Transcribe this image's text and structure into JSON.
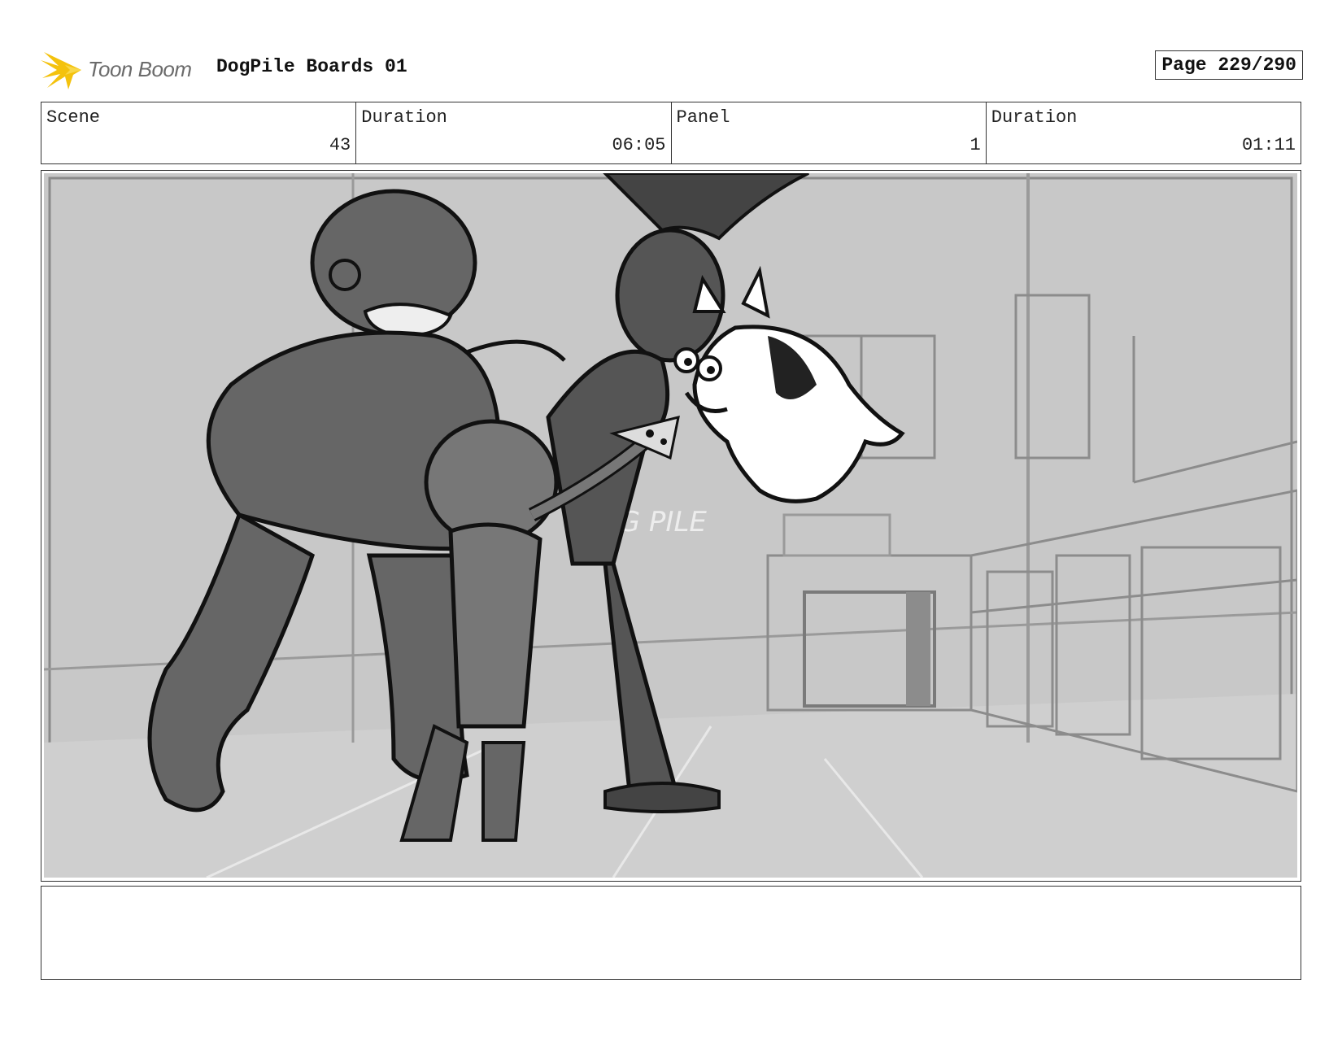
{
  "header": {
    "logo_text": "Toon Boom",
    "title": "DogPile Boards 01",
    "page_label": "Page 229/290"
  },
  "info": [
    {
      "label": "Scene",
      "value": "43"
    },
    {
      "label": "Duration",
      "value": "06:05"
    },
    {
      "label": "Panel",
      "value": "1"
    },
    {
      "label": "Duration",
      "value": "01:11"
    }
  ],
  "colors": {
    "logo_accent": "#f4c20d",
    "sketch_background": "#c8c8c8",
    "figure_dark": "#555555",
    "figure_mid": "#7a7a7a"
  },
  "panel": {
    "sign_text": "OG PILE"
  },
  "notes": {
    "text": ""
  }
}
